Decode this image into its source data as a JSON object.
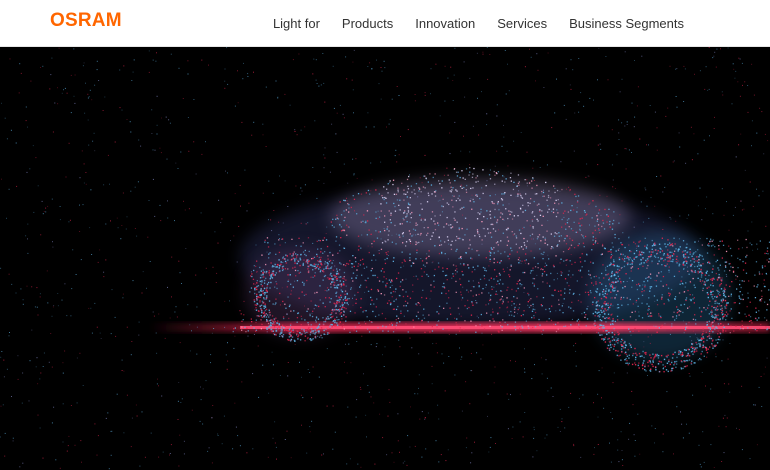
{
  "brand": {
    "logo_text": "OSRAM",
    "color": "#ff6600"
  },
  "nav": {
    "items": [
      {
        "label": "Light for"
      },
      {
        "label": "Products"
      },
      {
        "label": "Innovation"
      },
      {
        "label": "Services"
      },
      {
        "label": "Business Segments"
      }
    ]
  },
  "hero": {
    "image": "particle-car-visual",
    "colors": {
      "background": "#000000",
      "blue": "#5fb4e6",
      "red": "#e8264f",
      "pink": "#ff9ec0"
    }
  }
}
